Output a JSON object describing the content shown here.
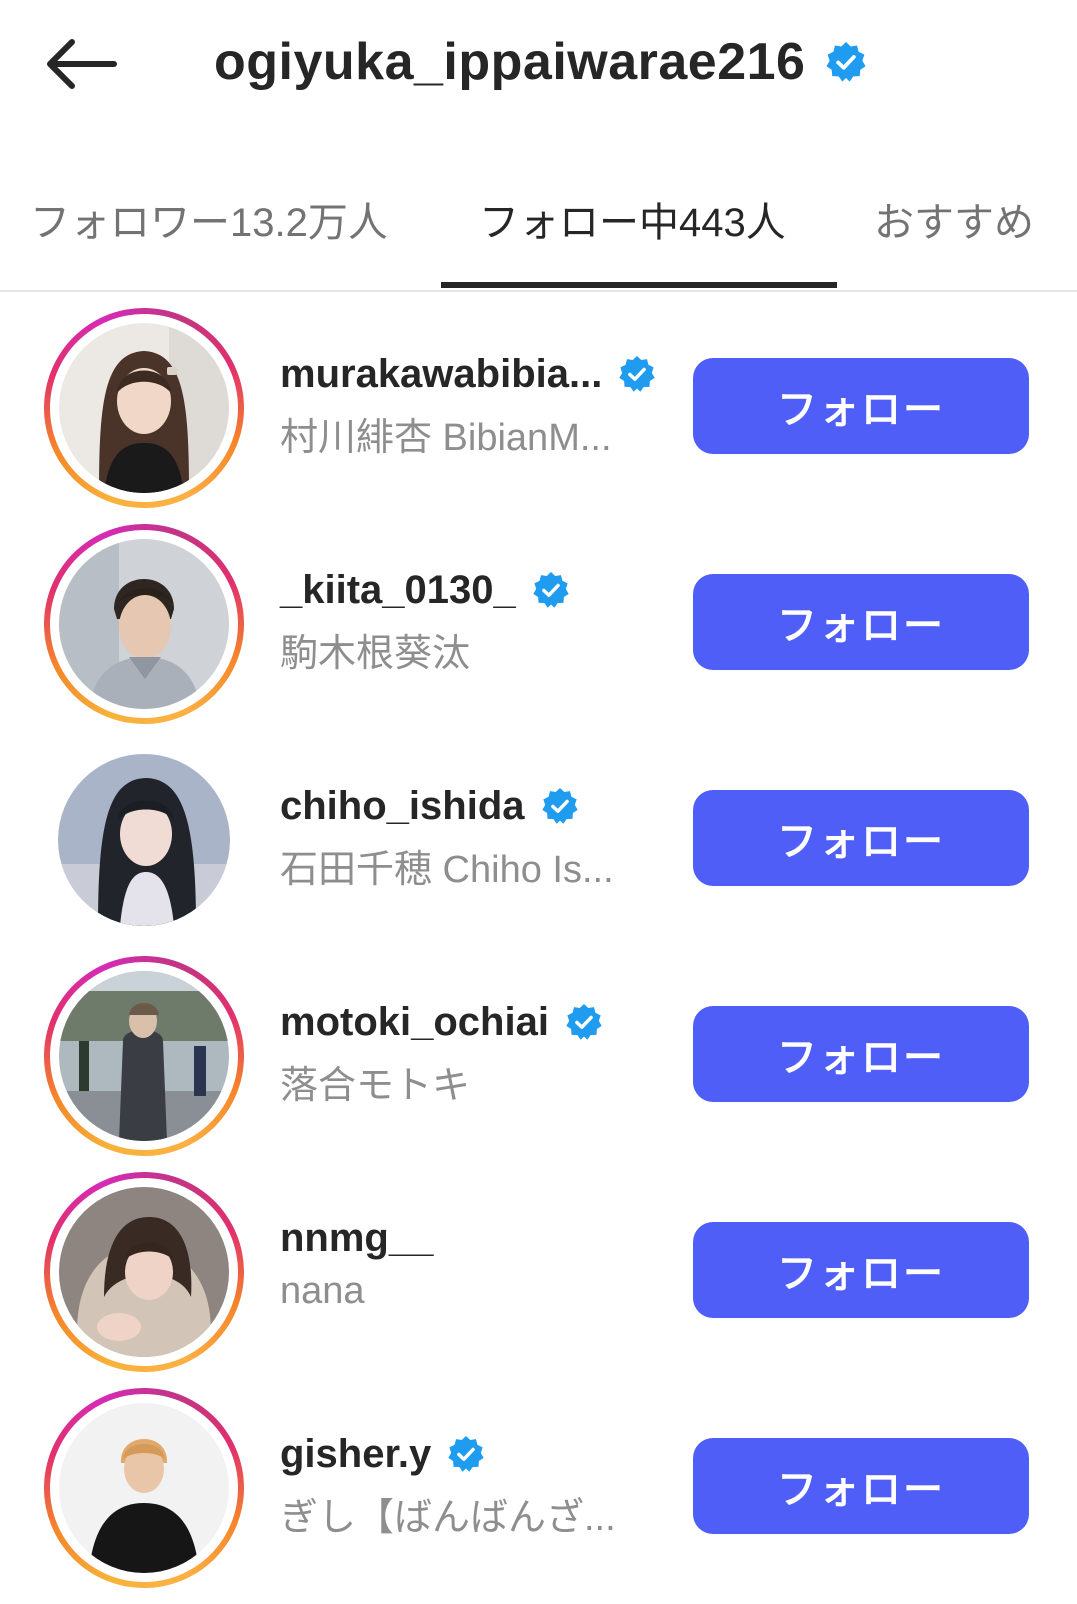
{
  "header": {
    "title": "ogiyuka_ippaiwarae216",
    "back_icon": "arrow-left-icon",
    "verified_icon": "verified-badge-icon"
  },
  "tabs": [
    {
      "label": "フォロワー13.2万人",
      "active": false
    },
    {
      "label": "フォロー中443人",
      "active": true
    },
    {
      "label": "おすすめ",
      "active": false
    }
  ],
  "colors": {
    "follow_button": "#4f5ef7",
    "verified_badge": "#1f9cf0",
    "secondary_text": "#8e8e8e"
  },
  "users": [
    {
      "username": "murakawabibia...",
      "fullname": "村川緋杏 BibianM...",
      "verified": true,
      "story_ring": true,
      "button_label": "フォロー"
    },
    {
      "username": "_kiita_0130_",
      "fullname": "駒木根葵汰",
      "verified": true,
      "story_ring": true,
      "button_label": "フォロー"
    },
    {
      "username": "chiho_ishida",
      "fullname": "石田千穂 Chiho Is...",
      "verified": true,
      "story_ring": false,
      "button_label": "フォロー"
    },
    {
      "username": "motoki_ochiai",
      "fullname": "落合モトキ",
      "verified": true,
      "story_ring": true,
      "button_label": "フォロー"
    },
    {
      "username": "nnmg__",
      "fullname": "nana",
      "verified": false,
      "story_ring": true,
      "button_label": "フォロー"
    },
    {
      "username": "gisher.y",
      "fullname": "ぎし【ばんばんざ...",
      "verified": true,
      "story_ring": true,
      "button_label": "フォロー"
    }
  ]
}
